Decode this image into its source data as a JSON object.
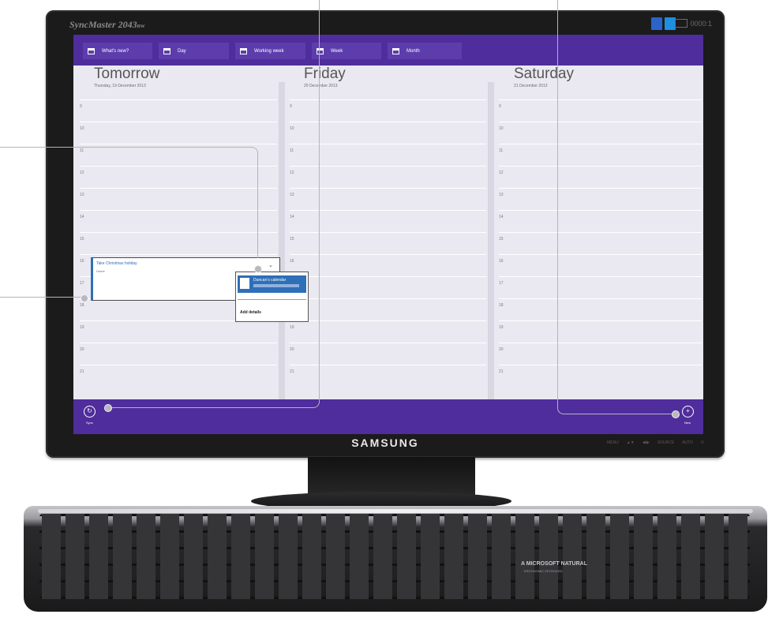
{
  "monitor": {
    "model": "SyncMaster 2043",
    "model_suffix": "BW",
    "contrast": "0000:1",
    "brand": "SAMSUNG",
    "controls": [
      "MENU",
      "▲▼",
      "◀/▶",
      "SOURCE",
      "AUTO",
      "⏻"
    ],
    "sticker_colors": [
      "#2b64c9",
      "#1c8fe0",
      "#2a2a2a"
    ]
  },
  "nav": {
    "items": [
      {
        "label": "What's new?"
      },
      {
        "label": "Day"
      },
      {
        "label": "Working week"
      },
      {
        "label": "Week"
      },
      {
        "label": "Month"
      }
    ]
  },
  "calendar": {
    "columns": [
      {
        "heading": "Tomorrow",
        "subheading": "Thursday, 19 December 2013"
      },
      {
        "heading": "Friday",
        "subheading": "20 December 2013"
      },
      {
        "heading": "Saturday",
        "subheading": "21 December 2013"
      }
    ],
    "hours": [
      "9",
      "10",
      "11",
      "12",
      "13",
      "14",
      "15",
      "16",
      "17",
      "18",
      "19",
      "20",
      "21"
    ]
  },
  "event": {
    "title": "Take Christmas holiday",
    "location": "Home",
    "chevron": "⌄"
  },
  "popup": {
    "calendar_name": "Duncan's calendar",
    "add_details": "Add details"
  },
  "appbar": {
    "sync_label": "Sync",
    "sync_icon": "↻",
    "new_label": "New",
    "new_icon": "+"
  },
  "keyboard": {
    "label": "A MICROSOFT NATURAL",
    "sublabel": "ERGONOMIC KEYBOARD"
  },
  "colors": {
    "accent": "#4f2d9c",
    "event_blue": "#2e6fb8",
    "screen_bg": "#eae9f1"
  }
}
